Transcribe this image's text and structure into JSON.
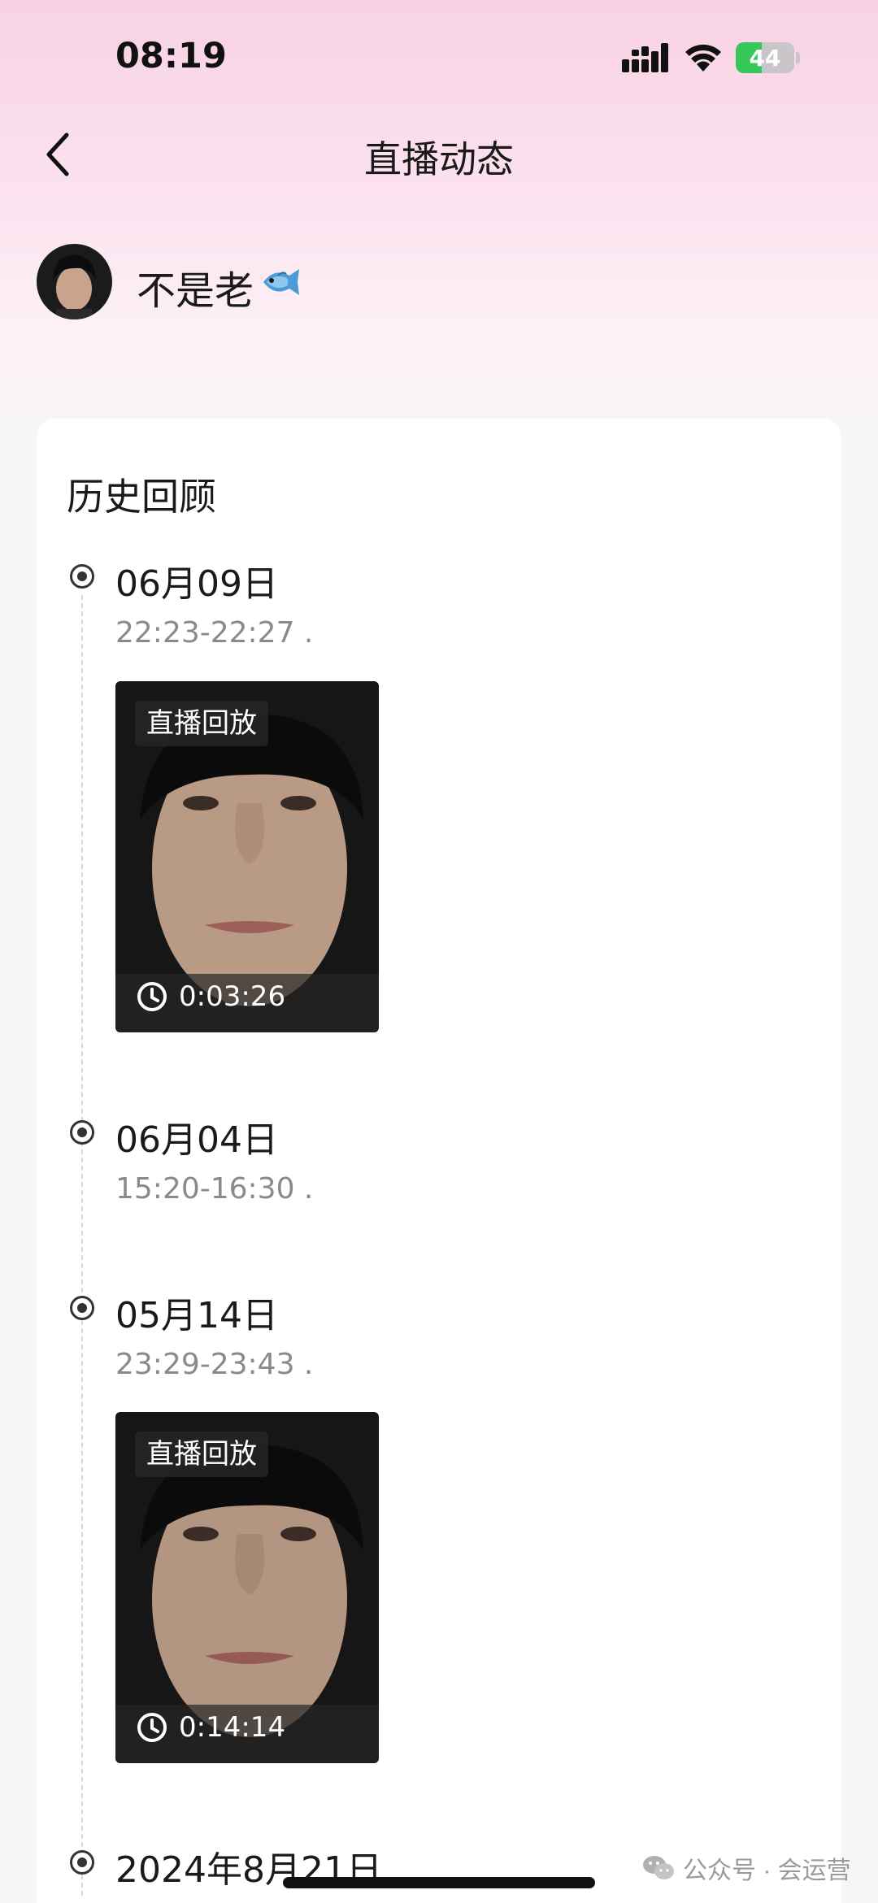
{
  "status_bar": {
    "time": "08:19",
    "battery_percent": 44,
    "battery_label": "44",
    "icons": [
      "signal-icon",
      "wifi-icon",
      "battery-icon"
    ]
  },
  "nav": {
    "title": "直播动态",
    "back_icon": "chevron-left-icon"
  },
  "profile": {
    "name": "不是老",
    "name_emoji_icon": "fish-icon"
  },
  "history": {
    "section_title": "历史回顾",
    "entries": [
      {
        "date": "06月09日",
        "time_range": "22:23-22:27 .",
        "replay": {
          "badge": "直播回放",
          "duration": "0:03:26"
        }
      },
      {
        "date": "06月04日",
        "time_range": "15:20-16:30 ."
      },
      {
        "date": "05月14日",
        "time_range": "23:29-23:43 .",
        "replay": {
          "badge": "直播回放",
          "duration": "0:14:14"
        }
      },
      {
        "date": "2024年8月21日"
      }
    ]
  },
  "watermark": {
    "text": "公众号 · 会运营",
    "icon": "wechat-icon"
  },
  "colors": {
    "header_gradient_top": "#f8d2e4",
    "page_background": "#f6f5f8",
    "card_background": "#ffffff",
    "secondary_text": "#8a8a8a",
    "battery_green": "#35c759"
  }
}
